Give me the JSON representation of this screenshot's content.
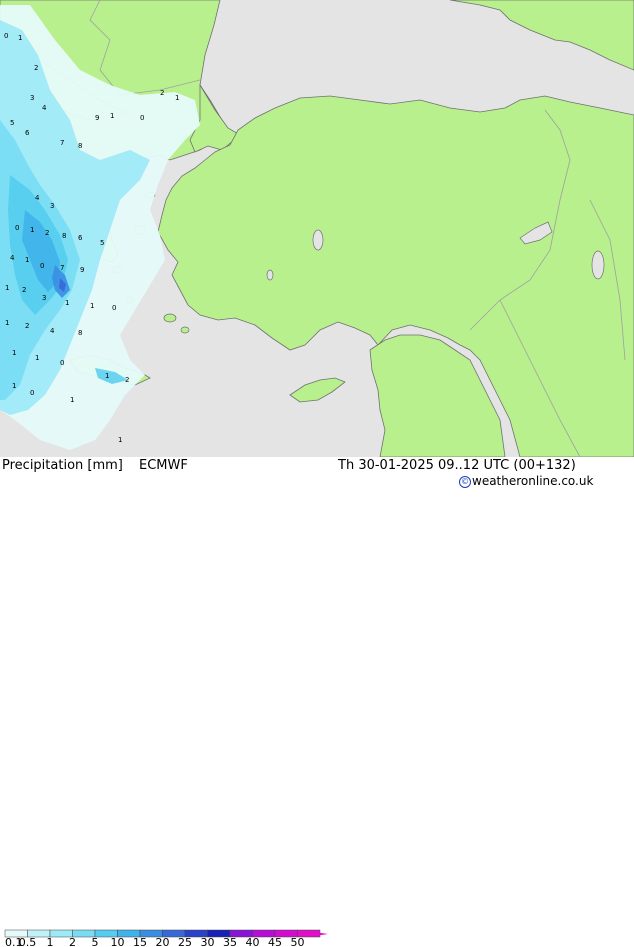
{
  "title": "Precipitation [mm]",
  "model": "ECMWF",
  "valid_time": "Th 30-01-2025 09..12 UTC (00+132)",
  "credit": "weatheronline.co.uk",
  "colors": {
    "land": "#b8f08e",
    "sea": "#e4e4e4",
    "border": "#a0a0a0",
    "coast": "#707070"
  },
  "legend": {
    "labels": [
      "0.1",
      "0.5",
      "1",
      "2",
      "5",
      "10",
      "15",
      "20",
      "25",
      "30",
      "35",
      "40",
      "45",
      "50"
    ],
    "colors": [
      "#e6fafa",
      "#bff2f8",
      "#9ce9f8",
      "#78ddf3",
      "#55cdf0",
      "#3fb2ea",
      "#3a8ee2",
      "#3668d8",
      "#2a41c9",
      "#1820b5",
      "#8a14d6",
      "#b60cd6",
      "#d40cd0",
      "#e00ec8"
    ]
  },
  "map_labels": [
    "0",
    "1",
    "2",
    "3",
    "4",
    "5",
    "6",
    "7",
    "8",
    "9",
    "1",
    "0",
    "2",
    "1",
    "4",
    "3",
    "0",
    "1",
    "2",
    "8",
    "6",
    "5",
    "4",
    "1",
    "0",
    "7",
    "9",
    "1",
    "2",
    "3",
    "1",
    "1",
    "0",
    "1",
    "2",
    "4",
    "8",
    "1",
    "1",
    "0",
    "1",
    "2",
    "1",
    "0",
    "1",
    "1"
  ]
}
